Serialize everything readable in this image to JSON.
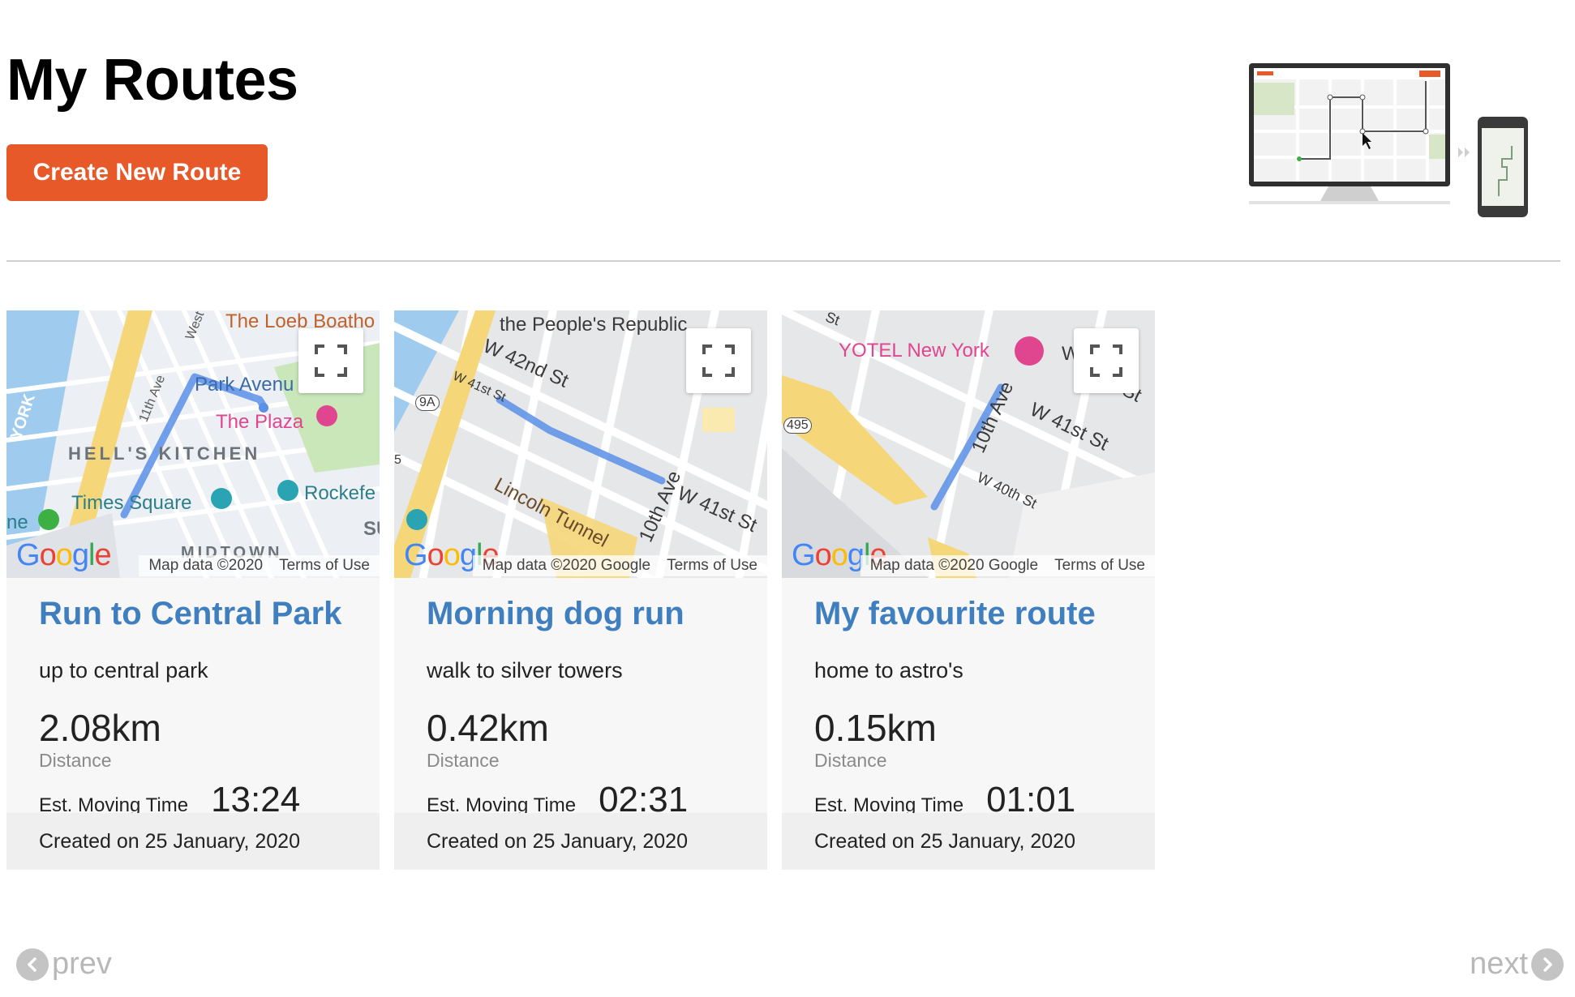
{
  "page": {
    "title": "My Routes",
    "create_label": "Create New Route"
  },
  "map_common": {
    "attribution": "Map data ©2020 Google",
    "attribution_short": "Map data ©2020",
    "terms": "Terms of Use"
  },
  "routes": [
    {
      "title": "Run to Central Park",
      "description": "up to central park",
      "distance": "2.08km",
      "distance_label": "Distance",
      "time_label": "Est. Moving Time",
      "time": "13:24",
      "created": "Created on 25 January, 2020",
      "map_labels": [
        "The Loeb Boatho",
        "Park Avenu",
        "The Plaza",
        "HELL'S KITCHEN",
        "Times Square",
        "Rockefe",
        "MIDTOWN",
        "11th Ave",
        "West",
        "ne",
        "SU",
        "YORK"
      ]
    },
    {
      "title": "Morning dog run",
      "description": "walk to silver towers",
      "distance": "0.42km",
      "distance_label": "Distance",
      "time_label": "Est. Moving Time",
      "time": "02:31",
      "created": "Created on 25 January, 2020",
      "map_labels": [
        "the People's Republic",
        "W 42nd St",
        "W 41st St",
        "W 41st St",
        "Lincoln Tunnel",
        "10th Ave",
        "9A",
        "5"
      ]
    },
    {
      "title": "My favourite route",
      "description": "home to astro's",
      "distance": "0.15km",
      "distance_label": "Distance",
      "time_label": "Est. Moving Time",
      "time": "01:01",
      "created": "Created on 25 January, 2020",
      "map_labels": [
        "YOTEL New York",
        "W 41st St",
        "10th Ave",
        "W 40th St",
        "495",
        "St",
        "W",
        "St"
      ]
    }
  ],
  "pagination": {
    "prev": "prev",
    "next": "next"
  },
  "colors": {
    "accent": "#e8592a",
    "route_title": "#3f7fbf",
    "route_line": "#5b8fe8",
    "poi_pink": "#e0458f",
    "poi_teal": "#2aa3b3"
  }
}
